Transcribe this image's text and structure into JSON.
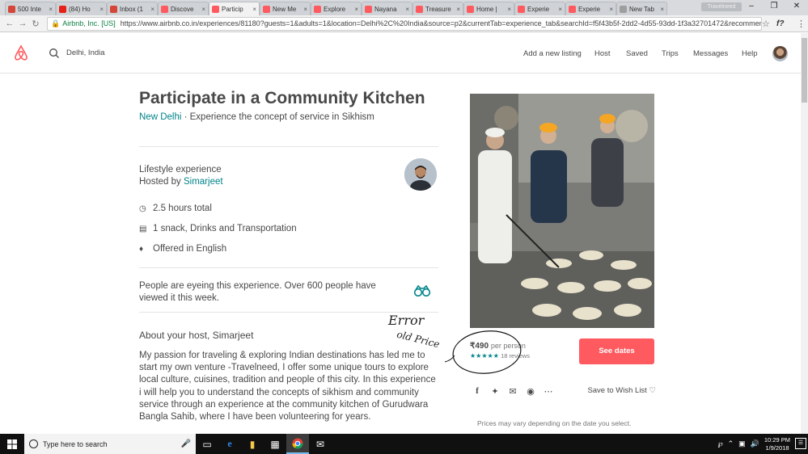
{
  "browser": {
    "tabs": [
      {
        "label": "500 Inte",
        "color": "#d44638"
      },
      {
        "label": "(84) Ho",
        "color": "#e62117"
      },
      {
        "label": "Inbox (1",
        "color": "#d44638"
      },
      {
        "label": "Discove",
        "color": "#ff5a5f"
      },
      {
        "label": "Particip",
        "color": "#ff5a5f",
        "active": true
      },
      {
        "label": "New Me",
        "color": "#ff5a5f"
      },
      {
        "label": "Explore",
        "color": "#ff5a5f"
      },
      {
        "label": "Nayana",
        "color": "#ff5a5f"
      },
      {
        "label": "Treasure",
        "color": "#ff5a5f"
      },
      {
        "label": "Home |",
        "color": "#ff5a5f"
      },
      {
        "label": "Experie",
        "color": "#ff5a5f"
      },
      {
        "label": "Experie",
        "color": "#ff5a5f"
      },
      {
        "label": "New Tab",
        "color": "#9e9e9e"
      }
    ],
    "profile_chip": "Travelneed",
    "site_identity": "Airbnb, Inc. [US]",
    "url": "https://www.airbnb.co.in/experiences/81180?guests=1&adults=1&location=Delhi%2C%20India&source=p2&currentTab=experience_tab&searchId=f5f43b5f-2dd2-4d55-93dd-1f3a32701472&recommen..."
  },
  "nav": {
    "search_value": "Delhi, India",
    "links": [
      "Add a new listing",
      "Host",
      "Saved",
      "Trips",
      "Messages",
      "Help"
    ]
  },
  "experience": {
    "title": "Participate in a Community Kitchen",
    "city": "New Delhi",
    "tagline": " · Experience the concept of service in Sikhism",
    "category": "Lifestyle experience",
    "hosted_by_prefix": "Hosted by ",
    "host_name": "Simarjeet",
    "details": [
      {
        "icon": "clock-icon",
        "text": "2.5 hours total"
      },
      {
        "icon": "food-icon",
        "text": "1 snack, Drinks and Transportation"
      },
      {
        "icon": "chat-icon",
        "text": "Offered in English"
      }
    ],
    "eyeing": "People are eyeing this experience. Over 600 people have viewed it this week.",
    "about_heading": "About your host, Simarjeet",
    "about_text": "My passion for traveling & exploring Indian destinations has led me to start my own venture -Travelneed, I offer some unique tours to explore local culture, cuisines, tradition and people of this city. In this experience i will help you to understand the concepts of sikhism and community service through an experience at the community kitchen of Gurudwara Bangla Sahib, where I have been volunteering for years."
  },
  "booking": {
    "price": "₹490",
    "per": "per person",
    "rating": 5,
    "stars": "★★★★★",
    "reviews": "18 reviews",
    "cta": "See dates",
    "save_label": "Save to Wish List",
    "note": "Prices may vary depending on the date you select."
  },
  "annotation": {
    "line1": "Error",
    "line2": "old Price"
  },
  "taskbar": {
    "search_placeholder": "Type here to search",
    "time": "10:29 PM",
    "date": "1/9/2018"
  }
}
